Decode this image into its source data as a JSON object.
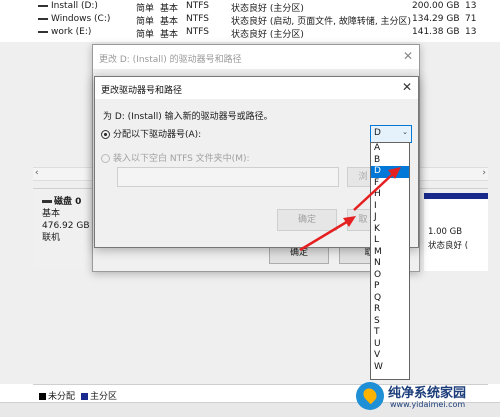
{
  "volumes": [
    {
      "name": "Install (D:)",
      "layout": "简单",
      "type": "基本",
      "fs": "NTFS",
      "status": "状态良好 (主分区)",
      "capacity": "200.00 GB",
      "free": "13"
    },
    {
      "name": "Windows (C:)",
      "layout": "简单",
      "type": "基本",
      "fs": "NTFS",
      "status": "状态良好 (启动, 页面文件, 故障转储, 主分区)",
      "capacity": "134.29 GB",
      "free": "71"
    },
    {
      "name": "work (E:)",
      "layout": "简单",
      "type": "基本",
      "fs": "NTFS",
      "status": "状态良好 (主分区)",
      "capacity": "141.38 GB",
      "free": "13"
    }
  ],
  "scroll": {
    "left": "‹",
    "right": "›"
  },
  "disk": {
    "title": "磁盘 0",
    "type": "基本",
    "size": "476.92 GB",
    "state": "联机"
  },
  "partition_right": {
    "size": "1.00 GB",
    "status": "状态良好 ("
  },
  "legend": [
    {
      "label": "未分配",
      "color": "#000000"
    },
    {
      "label": "主分区",
      "color": "#1a2a8c"
    }
  ],
  "outer_dialog": {
    "title": "更改 D: (Install) 的驱动器号和路径",
    "close": "✕",
    "ok": "确定",
    "cancel": "取"
  },
  "inner_dialog": {
    "title": "更改驱动器号和路径",
    "close": "✕",
    "instruction": "为 D: (Install) 输入新的驱动器号或路径。",
    "option_letter": "分配以下驱动器号(A):",
    "option_folder": "装入以下空白 NTFS 文件夹中(M):",
    "browse": "浏",
    "ok": "确定",
    "cancel": "取"
  },
  "drive_letter": {
    "selected": "D",
    "options": [
      "A",
      "B",
      "D",
      "F",
      "H",
      "I",
      "J",
      "K",
      "L",
      "M",
      "N",
      "O",
      "P",
      "Q",
      "R",
      "S",
      "T",
      "U",
      "V",
      "W"
    ],
    "highlighted": "D"
  },
  "watermark": {
    "name": "纯净系统家园",
    "url": "www.yidaimei.com"
  },
  "colors": {
    "accent": "#0078d7",
    "annotation": "#e52020",
    "primary_partition": "#1a2a8c"
  }
}
